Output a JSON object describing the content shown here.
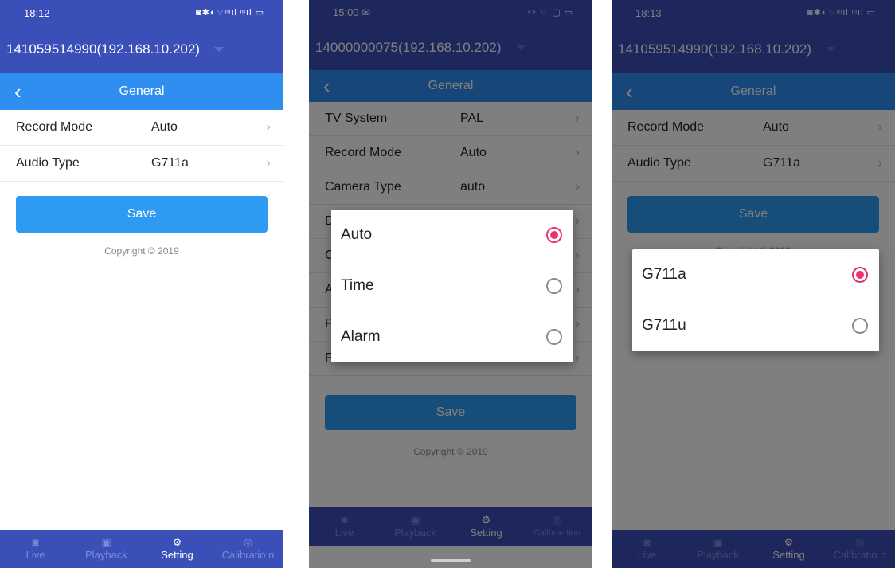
{
  "screen1": {
    "status_time": "18:12",
    "status_icons": "◙✱◐⌔ᵐıl ᵐıl ▭",
    "device": "141059514990(192.168.10.202)",
    "nav_back": "‹",
    "nav_title": "General",
    "rows": [
      {
        "label": "Record Mode",
        "value": "Auto",
        "arrow": "›"
      },
      {
        "label": "Audio Type",
        "value": "G711a",
        "arrow": "›"
      }
    ],
    "save_label": "Save",
    "copyright": "Copyright © 2019",
    "tabs": [
      {
        "icon": "◙",
        "label": "Live"
      },
      {
        "icon": "▣",
        "label": "Playback"
      },
      {
        "icon": "⚙",
        "label": "Setting"
      },
      {
        "icon": "◎",
        "label": "Calibratio n"
      }
    ]
  },
  "screen2": {
    "status_time": "15:00 ✉",
    "status_icons": "⁴⁶ ⌔ ▢ ▭",
    "device": "14000000075(192.168.10.202)",
    "nav_back": "‹",
    "nav_title": "General",
    "rows": [
      {
        "label": "TV System",
        "value": "PAL",
        "arrow": "›"
      },
      {
        "label": "Record Mode",
        "value": "Auto",
        "arrow": "›"
      },
      {
        "label": "Camera Type",
        "value": "auto",
        "arrow": "›"
      },
      {
        "label": "D",
        "value": "",
        "arrow": "›"
      },
      {
        "label": "C",
        "value": "",
        "arrow": "›"
      },
      {
        "label": "A",
        "value": "",
        "arrow": "›"
      },
      {
        "label": "P",
        "value": "",
        "arrow": "›"
      },
      {
        "label": "P",
        "value": "",
        "arrow": "›"
      }
    ],
    "save_label": "Save",
    "copyright": "Copyright © 2019",
    "dialog_options": [
      {
        "label": "Auto",
        "selected": true
      },
      {
        "label": "Time",
        "selected": false
      },
      {
        "label": "Alarm",
        "selected": false
      }
    ],
    "tabs": [
      {
        "icon": "◙",
        "label": "Live"
      },
      {
        "icon": "▣",
        "label": "Playback"
      },
      {
        "icon": "⚙",
        "label": "Setting"
      },
      {
        "icon": "◎",
        "label": "Calibra- tion"
      }
    ]
  },
  "screen3": {
    "status_time": "18:13",
    "status_icons": "◙✱◐⌔ᵐıl ᵐıl ▭",
    "device": "141059514990(192.168.10.202)",
    "nav_back": "‹",
    "nav_title": "General",
    "rows": [
      {
        "label": "Record Mode",
        "value": "Auto",
        "arrow": "›"
      },
      {
        "label": "Audio Type",
        "value": "G711a",
        "arrow": "›"
      }
    ],
    "save_label": "Save",
    "copyright": "Copyright © 2019",
    "dialog_options": [
      {
        "label": "G711a",
        "selected": true
      },
      {
        "label": "G711u",
        "selected": false
      }
    ],
    "tabs": [
      {
        "icon": "◙",
        "label": "Live"
      },
      {
        "icon": "▣",
        "label": "Playback"
      },
      {
        "icon": "⚙",
        "label": "Setting"
      },
      {
        "icon": "◎",
        "label": "Calibratio n"
      }
    ]
  },
  "colors": {
    "header": "#3b4fb8",
    "nav": "#2e8ff0",
    "button": "#2e9af2",
    "radio_selected": "#e8336e"
  }
}
